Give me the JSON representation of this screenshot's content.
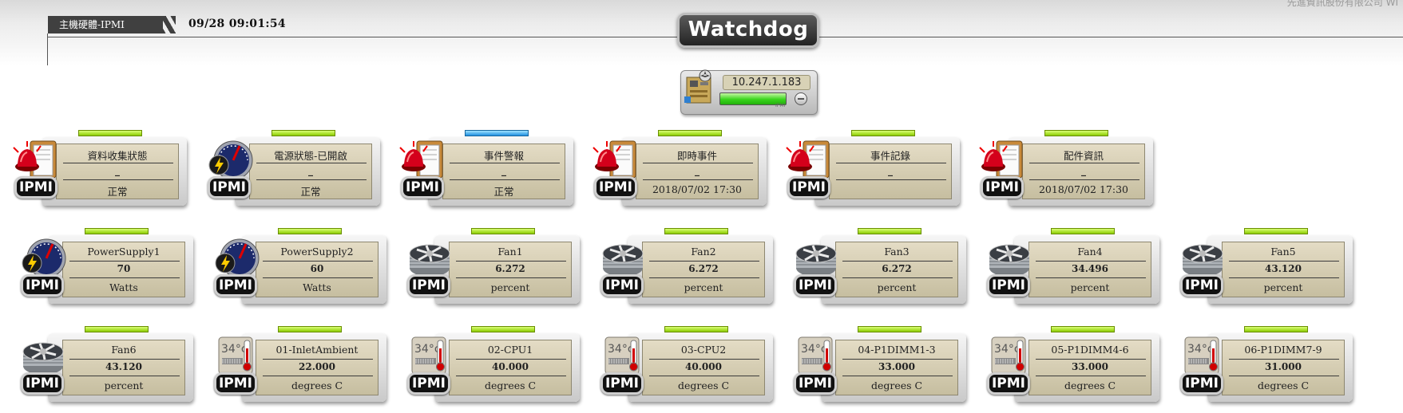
{
  "header": {
    "company": "先進資訊股份有限公司  WI",
    "title": "主機硬體-IPMI",
    "datetime": "09/28 09:01:54",
    "logo": "Watchdog"
  },
  "server": {
    "ip": "10.247.1.183",
    "badge": "IPMI"
  },
  "ipmi_label": "IPMI",
  "tiles": [
    {
      "icon": "alarm-siren-icon",
      "label": "資料收集狀態",
      "value": "_",
      "status": "正常",
      "bar": "green"
    },
    {
      "icon": "power-gauge-icon",
      "label": "電源狀態-已開啟",
      "value": "_",
      "status": "正常",
      "bar": "green"
    },
    {
      "icon": "alarm-siren-icon",
      "label": "事件警報",
      "value": "_",
      "status": "正常",
      "bar": "blue"
    },
    {
      "icon": "alarm-siren-icon",
      "label": "即時事件",
      "value": "_",
      "status": "2018/07/02 17:30",
      "bar": "green"
    },
    {
      "icon": "alarm-siren-icon",
      "label": "事件記錄",
      "value": "_",
      "status": "",
      "bar": "green"
    },
    {
      "icon": "alarm-siren-icon",
      "label": "配件資訊",
      "value": "_",
      "status": "2018/07/02 17:30",
      "bar": "green"
    },
    {
      "icon": "power-gauge-icon",
      "label": "PowerSupply1",
      "value": "70",
      "status": "Watts",
      "bar": "green"
    },
    {
      "icon": "power-gauge-icon",
      "label": "PowerSupply2",
      "value": "60",
      "status": "Watts",
      "bar": "green"
    },
    {
      "icon": "fan-icon",
      "label": "Fan1",
      "value": "6.272",
      "status": "percent",
      "bar": "green"
    },
    {
      "icon": "fan-icon",
      "label": "Fan2",
      "value": "6.272",
      "status": "percent",
      "bar": "green"
    },
    {
      "icon": "fan-icon",
      "label": "Fan3",
      "value": "6.272",
      "status": "percent",
      "bar": "green"
    },
    {
      "icon": "fan-icon",
      "label": "Fan4",
      "value": "34.496",
      "status": "percent",
      "bar": "green"
    },
    {
      "icon": "fan-icon",
      "label": "Fan5",
      "value": "43.120",
      "status": "percent",
      "bar": "green"
    },
    {
      "icon": "fan-icon",
      "label": "Fan6",
      "value": "43.120",
      "status": "percent",
      "bar": "green"
    },
    {
      "icon": "thermometer-icon",
      "label": "01-InletAmbient",
      "value": "22.000",
      "status": "degrees C",
      "bar": "green"
    },
    {
      "icon": "thermometer-icon",
      "label": "02-CPU1",
      "value": "40.000",
      "status": "degrees C",
      "bar": "green"
    },
    {
      "icon": "thermometer-icon",
      "label": "03-CPU2",
      "value": "40.000",
      "status": "degrees C",
      "bar": "green"
    },
    {
      "icon": "thermometer-icon",
      "label": "04-P1DIMM1-3",
      "value": "33.000",
      "status": "degrees C",
      "bar": "green"
    },
    {
      "icon": "thermometer-icon",
      "label": "05-P1DIMM4-6",
      "value": "33.000",
      "status": "degrees C",
      "bar": "green"
    },
    {
      "icon": "thermometer-icon",
      "label": "06-P1DIMM7-9",
      "value": "31.000",
      "status": "degrees C",
      "bar": "green"
    }
  ],
  "thermo_text": "34°c"
}
